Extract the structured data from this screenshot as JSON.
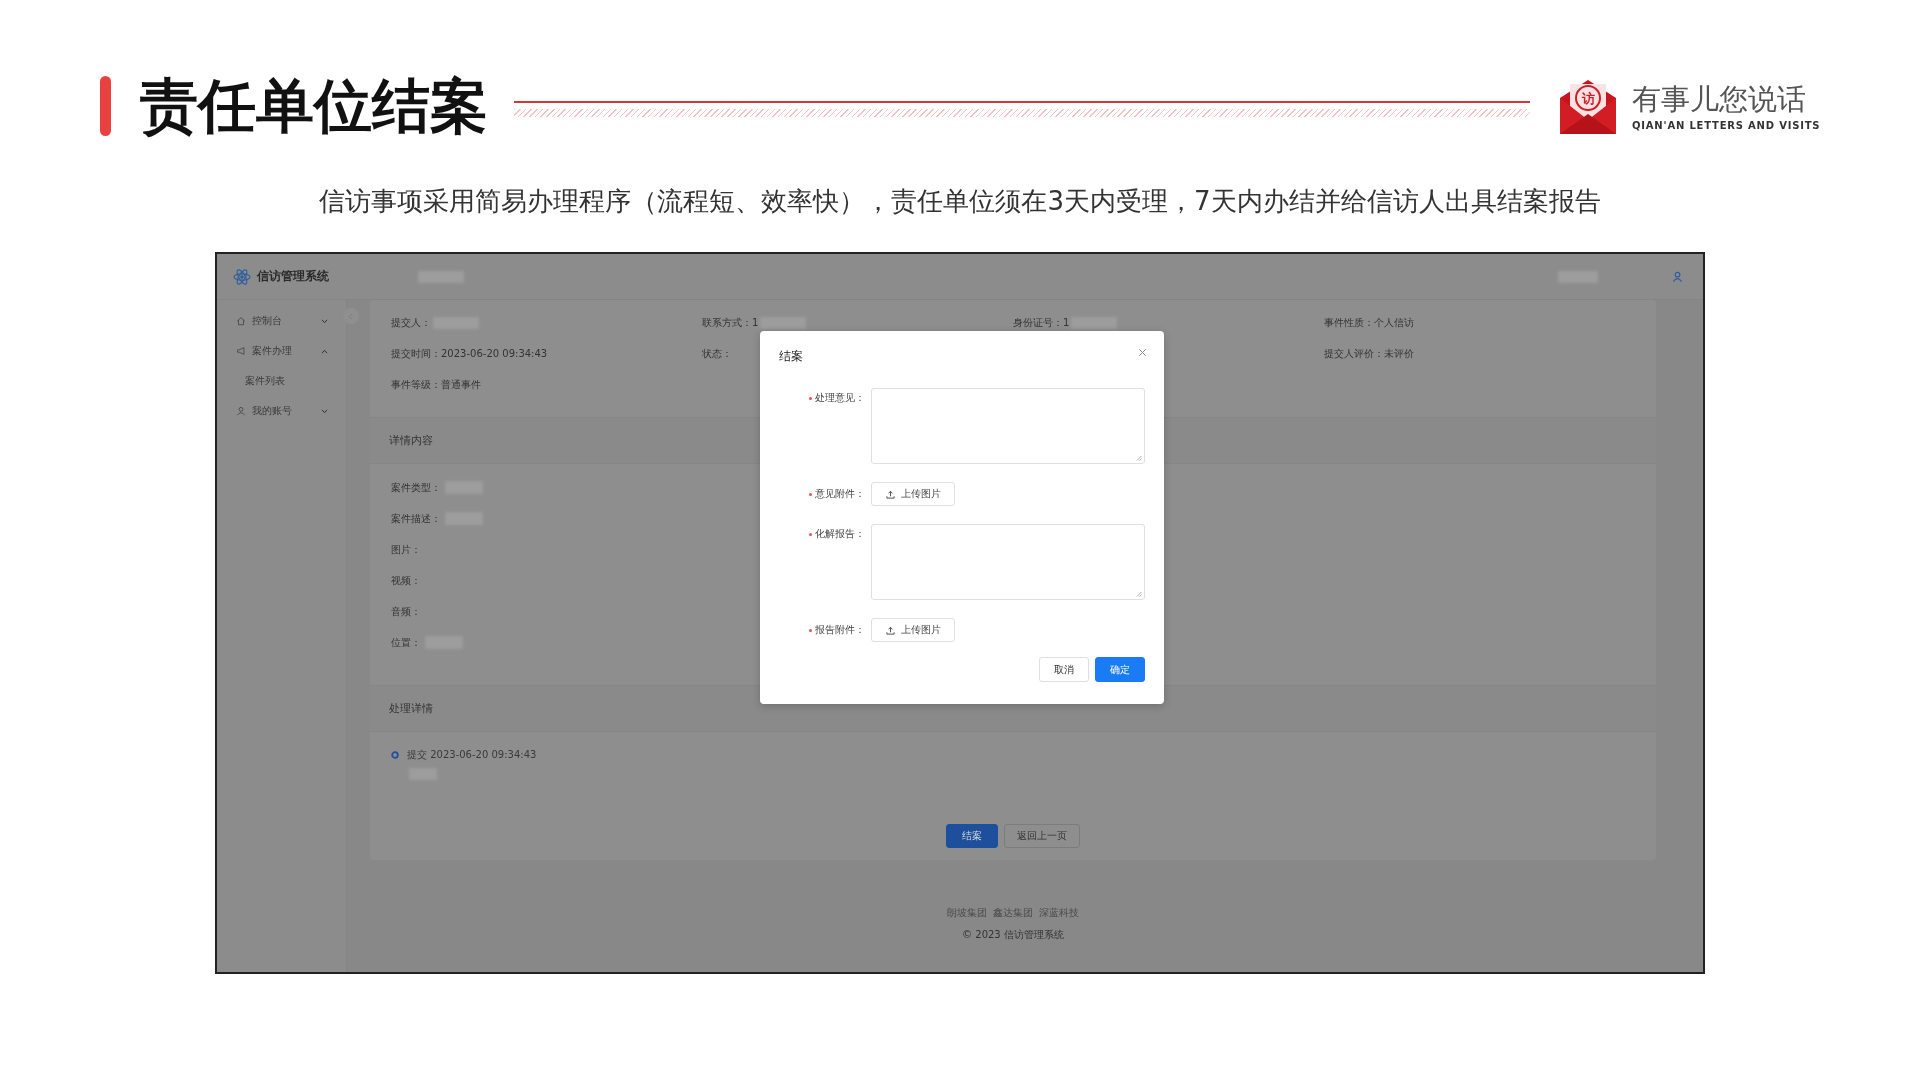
{
  "slide": {
    "title": "责任单位结案",
    "logo": {
      "badge": "访",
      "name": "有事儿您说话",
      "tagline": "QIAN'AN LETTERS AND VISITS"
    },
    "subtitle": "信访事项采用简易办理程序（流程短、效率快），责任单位须在3天内受理，7天内办结并给信访人出具结案报告"
  },
  "app": {
    "name": "信访管理系统",
    "sidebar": {
      "items": [
        {
          "label": "控制台",
          "expanded": false
        },
        {
          "label": "案件办理",
          "expanded": true,
          "children": [
            {
              "label": "案件列表"
            }
          ]
        },
        {
          "label": "我的账号",
          "expanded": false
        }
      ]
    },
    "info_columns": [
      [
        {
          "label": "提交人：",
          "redacted": true
        },
        {
          "label": "提交时间：",
          "value": "2023-06-20 09:34:43"
        },
        {
          "label": "事件等级：",
          "value": "普通事件"
        }
      ],
      [
        {
          "label": "联系方式：",
          "value": "1",
          "redacted": true
        },
        {
          "label": "状态："
        }
      ],
      [
        {
          "label": "身份证号：",
          "value": "1",
          "redacted": true
        }
      ],
      [
        {
          "label": "事件性质：",
          "value": "个人信访"
        },
        {
          "label": "提交人评价：",
          "value": "未评价"
        }
      ]
    ],
    "details": {
      "title": "详情内容",
      "fields": [
        {
          "label": "案件类型：",
          "redacted": true
        },
        {
          "label": "案件描述：",
          "redacted": true
        },
        {
          "label": "图片："
        },
        {
          "label": "视频："
        },
        {
          "label": "音频："
        },
        {
          "label": "位置：",
          "redacted": true
        }
      ]
    },
    "history": {
      "title": "处理详情",
      "entries": [
        {
          "text": "提交 2023-06-20 09:34:43",
          "redacted": true
        }
      ]
    },
    "actions": [
      {
        "label": "结案",
        "primary": true
      },
      {
        "label": "返回上一页",
        "primary": false
      }
    ],
    "footer": {
      "links": [
        "朗坡集团",
        "鑫达集团",
        "深蓝科技"
      ],
      "copyright": "© 2023 信访管理系统"
    }
  },
  "dialog": {
    "title": "结案",
    "fields": [
      {
        "label": "处理意见：",
        "required": true,
        "kind": "textarea"
      },
      {
        "label": "意见附件：",
        "required": true,
        "kind": "upload",
        "button": "上传图片"
      },
      {
        "label": "化解报告：",
        "required": true,
        "kind": "textarea"
      },
      {
        "label": "报告附件：",
        "required": true,
        "kind": "upload",
        "button": "上传图片"
      }
    ],
    "buttons": [
      {
        "label": "取消",
        "primary": false
      },
      {
        "label": "确定",
        "primary": true
      }
    ]
  }
}
